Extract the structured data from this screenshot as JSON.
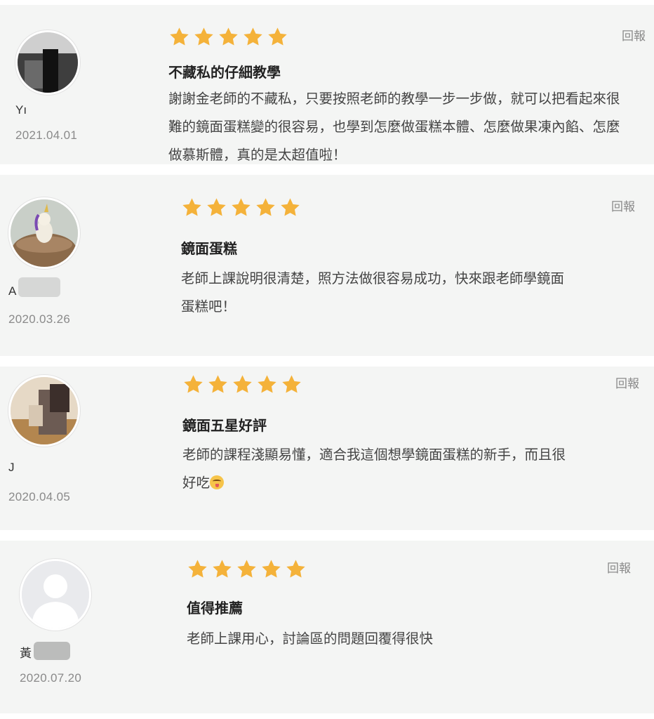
{
  "reviews": [
    {
      "reviewer_name": "Yı",
      "date": "2021.04.01",
      "rating": 5,
      "title": "不藏私的仔細教學",
      "body_lines": [
        "謝謝金老師的不藏私，只要按照老師的教學一步一步做，就可以把看起來很",
        "難的鏡面蛋糕變的很容易，也學到怎麼做蛋糕本體、怎麼做果凍內餡、怎麼",
        "做慕斯體，真的是太超值啦！"
      ],
      "report_label": "回報",
      "avatar": "blurred-photo"
    },
    {
      "reviewer_name": "A",
      "date": "2020.03.26",
      "rating": 5,
      "title": "鏡面蛋糕",
      "body_lines": [
        "老師上課說明很清楚，照方法做很容易成功，快來跟老師學鏡面",
        "蛋糕吧！"
      ],
      "report_label": "回報",
      "avatar": "cake-photo"
    },
    {
      "reviewer_name": "J",
      "date": "2020.04.05",
      "rating": 5,
      "title": "鏡面五星好評",
      "body_lines": [
        "老師的課程淺顯易懂，適合我這個想學鏡面蛋糕的新手，而且很",
        "好吃"
      ],
      "body_emoji": "yum-face-emoji",
      "report_label": "回報",
      "avatar": "blurred-photo"
    },
    {
      "reviewer_name": "黃",
      "date": "2020.07.20",
      "rating": 5,
      "title": "值得推薦",
      "body_lines": [
        "老師上課用心，討論區的問題回覆得很快"
      ],
      "report_label": "回報",
      "avatar": "default-user-icon"
    }
  ],
  "colors": {
    "card_background": "#f4f5f4",
    "star": "#f4b23a",
    "text_primary": "#222222",
    "text_secondary": "#8a8a8a"
  }
}
